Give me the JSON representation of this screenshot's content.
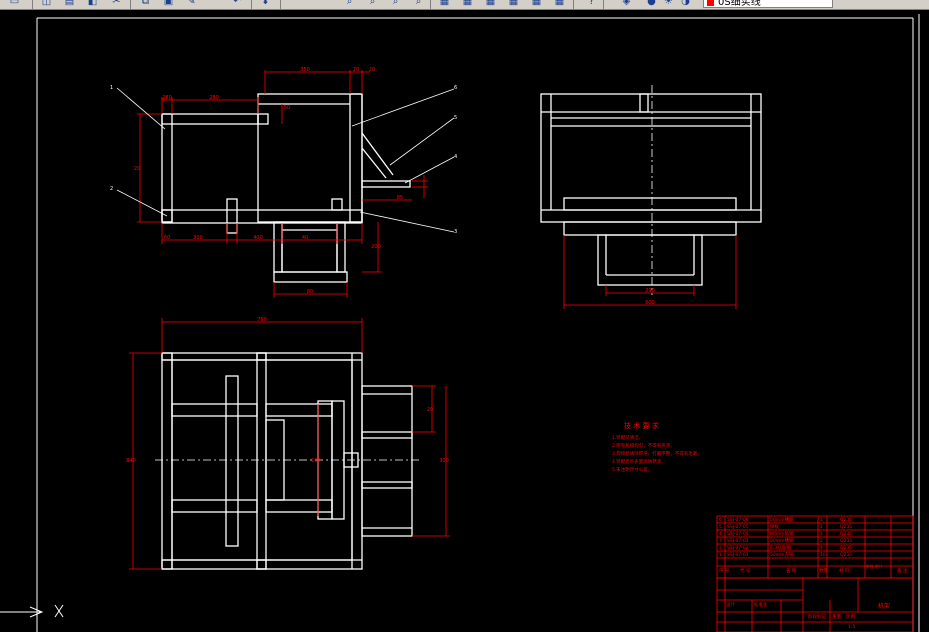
{
  "toolbar": {
    "layer_name": "0S细实线",
    "layer_color": "#ff0000",
    "buttons": [
      "save-icon",
      "open-icon",
      "print-icon",
      "preview-icon",
      "cut-icon",
      "copy-icon",
      "paste-icon",
      "match-icon",
      "undo-icon",
      "pan-icon",
      "zoom-icon",
      "zoom-window-icon",
      "zoom-prev-icon",
      "properties-icon",
      "design-center-icon",
      "tool-palette-icon",
      "calculator-icon",
      "grid-icon",
      "help-icon",
      "layer-manager-icon",
      "bulb-icon",
      "sun-icon",
      "lock-icon"
    ]
  },
  "drawing": {
    "front_view_dims": [
      "350",
      "20",
      "20",
      "280",
      "280",
      "50",
      "20",
      "300",
      "400",
      "40",
      "60",
      "200",
      "80",
      "85"
    ],
    "front_view_balloons": [
      "1",
      "2",
      "6",
      "5",
      "4",
      "3"
    ],
    "side_view_dims": [
      "290",
      "600"
    ],
    "top_view_dims": [
      "780",
      "840",
      "20",
      "100",
      "300"
    ],
    "notes_title": "技 术 要 求",
    "notes": [
      "1.装配前清洁。",
      "2.所有焦缝均匀，不得有夹渣。",
      "3.焊接后清除焊渣，打磨平整，不得有毛刺。",
      "4.装配后外表面涂防锈漆。",
      "5.未注明尺寸公差。"
    ],
    "bom_rows": [
      {
        "no": "6",
        "code": "SSJ-07-06",
        "name": "50mm槽钢",
        "qty": "1",
        "mat": "Q235"
      },
      {
        "no": "5",
        "code": "SSJ-07-05",
        "name": "钢板",
        "qty": "1",
        "mat": "Q235"
      },
      {
        "no": "4",
        "code": "SSJ-07-04",
        "name": "80mm角钢",
        "qty": "1",
        "mat": "Q235"
      },
      {
        "no": "3",
        "code": "SSJ-07-03",
        "name": "80mm槽钢",
        "qty": "2",
        "mat": "Q235"
      },
      {
        "no": "2",
        "code": "SSJ-07-02",
        "name": "6.3号角钢",
        "qty": "4",
        "mat": "Q235"
      },
      {
        "no": "1",
        "code": "SSJ-07-01",
        "name": "50mm方钢",
        "qty": "10",
        "mat": "Q235"
      }
    ],
    "bom_header": [
      "序 号",
      "代 号",
      "名 称",
      "数量",
      "材 料",
      "单件 总计",
      "备 注"
    ],
    "title_block_name": "机架",
    "title_block_labels": [
      "设计",
      "标准化",
      "阶段标记",
      "重量",
      "比例"
    ],
    "title_block_scale": "1:5"
  },
  "colors": {
    "line": "#ffffff",
    "dim": "#ff0000",
    "bg": "#000000",
    "center": "#ffffff"
  }
}
